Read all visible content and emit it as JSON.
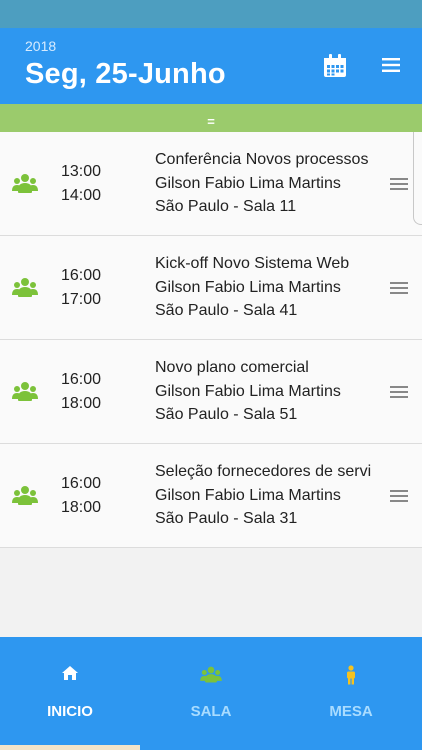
{
  "header": {
    "year": "2018",
    "date": "Seg, 25-Junho",
    "calendar_icon": "calendar-icon",
    "menu_icon": "hamburger-menu-icon"
  },
  "filter_bar": {
    "label": "="
  },
  "events": [
    {
      "start": "13:00",
      "end": "14:00",
      "title": "Conferência Novos processos",
      "organizer": "Gilson Fabio Lima Martins",
      "location": "São Paulo - Sala 11"
    },
    {
      "start": "16:00",
      "end": "17:00",
      "title": "Kick-off Novo Sistema Web",
      "organizer": "Gilson Fabio Lima Martins",
      "location": "São Paulo - Sala 41"
    },
    {
      "start": "16:00",
      "end": "18:00",
      "title": "Novo plano comercial",
      "organizer": "Gilson Fabio Lima Martins",
      "location": "São Paulo - Sala 51"
    },
    {
      "start": "16:00",
      "end": "18:00",
      "title": "Seleção fornecedores de servi",
      "organizer": "Gilson Fabio Lima Martins",
      "location": "São Paulo - Sala 31"
    }
  ],
  "nav": {
    "inicio": "INICIO",
    "sala": "SALA",
    "mesa": "MESA",
    "active": "inicio"
  },
  "colors": {
    "primary": "#2e97f0",
    "status_bar": "#4d9ec0",
    "filter_bar": "#9bcb6c",
    "group_icon": "#7cc23a",
    "person_icon": "#f4c21f",
    "nav_inactive_label": "#a9dcff"
  }
}
